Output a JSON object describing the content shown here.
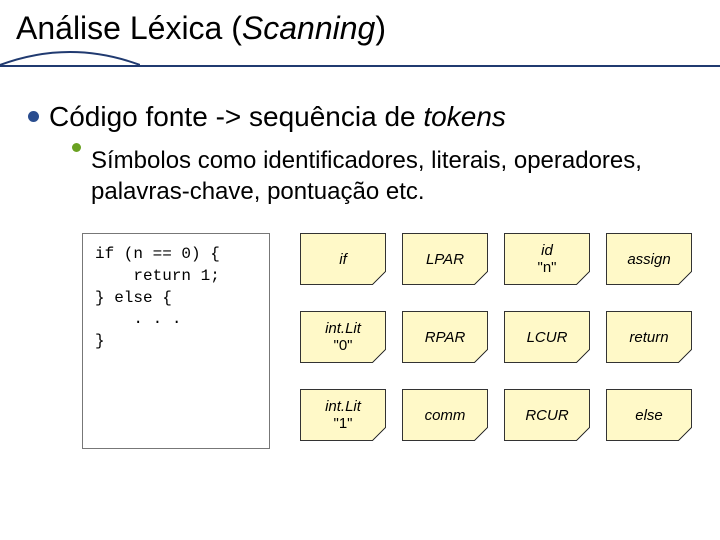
{
  "title": {
    "plain": "Análise Léxica (",
    "italic": "Scanning",
    "close": ")"
  },
  "bullet1": {
    "pre": "Código fonte -> sequência de ",
    "italic": "tokens"
  },
  "bullet2": "Símbolos como identificadores, literais, operadores, palavras-chave, pontuação etc.",
  "code": "if (n == 0) {\n    return 1;\n} else {\n    . . .\n}",
  "tokens": [
    [
      {
        "l1": "if"
      },
      {
        "l1": "LPAR"
      },
      {
        "l1": "id",
        "l2": "\"n\""
      },
      {
        "l1": "assign"
      }
    ],
    [
      {
        "l1": "int.Lit",
        "l2": "\"0\""
      },
      {
        "l1": "RPAR"
      },
      {
        "l1": "LCUR"
      },
      {
        "l1": "return"
      }
    ],
    [
      {
        "l1": "int.Lit",
        "l2": "\"1\""
      },
      {
        "l1": "comm"
      },
      {
        "l1": "RCUR"
      },
      {
        "l1": "else"
      }
    ]
  ]
}
